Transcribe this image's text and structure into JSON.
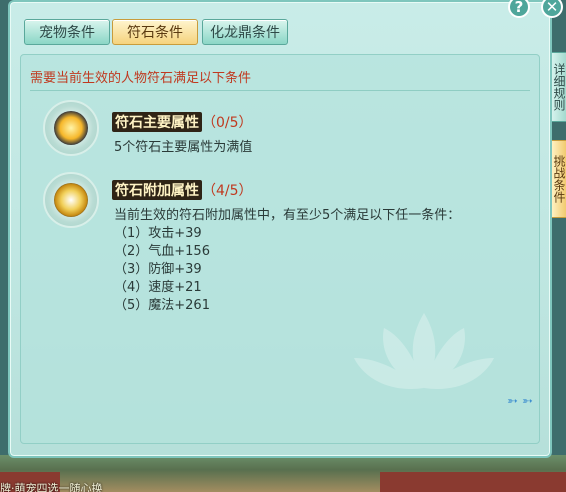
{
  "tabs": [
    {
      "label": "宠物条件"
    },
    {
      "label": "符石条件"
    },
    {
      "label": "化龙鼎条件"
    }
  ],
  "requirement": "需要当前生效的人物符石满足以下条件",
  "conditions": {
    "main": {
      "title": "符石主要属性",
      "progress": "（0/5）",
      "desc": "5个符石主要属性为满值"
    },
    "extra": {
      "title": "符石附加属性",
      "progress": "（4/5）",
      "desc": "当前生效的符石附加属性中，有至少5个满足以下任一条件：",
      "options": [
        "（1）攻击+39",
        "（2）气血+156",
        "（3）防御+39",
        "（4）速度+21",
        "（5）魔法+261"
      ]
    }
  },
  "side_tabs": {
    "detail": "详细规则",
    "challenge": "挑战条件"
  },
  "buttons": {
    "help": "?",
    "close": "✕"
  },
  "scene_caption": "牌·萌宠四选一随心换"
}
